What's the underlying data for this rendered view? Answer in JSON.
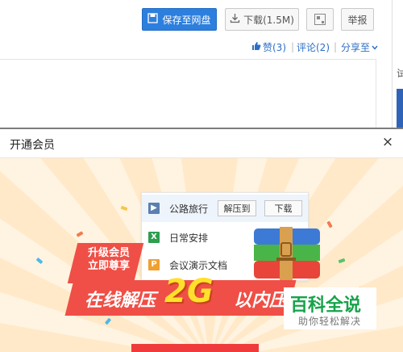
{
  "toolbar": {
    "save_label": "保存至网盘",
    "download_label": "下载(1.5M)",
    "report_label": "举报"
  },
  "social": {
    "like_label": "赞(3)",
    "comment_label": "评论(2)",
    "share_label": "分享至"
  },
  "sidebar": {
    "char": "试"
  },
  "modal": {
    "title": "开通会员",
    "close_glyph": "×"
  },
  "files": [
    {
      "name": "公路旅行",
      "icon": "video-file-icon",
      "color": "#5b7fb0",
      "glyph": "▶"
    },
    {
      "name": "日常安排",
      "icon": "excel-file-icon",
      "color": "#2e9e4f",
      "glyph": "X"
    },
    {
      "name": "会议演示文档",
      "icon": "ppt-file-icon",
      "color": "#f0a030",
      "glyph": "P"
    }
  ],
  "file_actions": {
    "extract_label": "解压到",
    "download_label": "下载"
  },
  "promo": {
    "upgrade_line1": "升级会员",
    "upgrade_line2": "立即尊享",
    "headline_left": "在线解压",
    "headline_big": "2G",
    "headline_right": "以内压缩"
  },
  "watermark": {
    "title": "百科全说",
    "subtitle": "助你轻松解决"
  },
  "colors": {
    "primary": "#2d7fde",
    "promo_red": "#ef4f46",
    "promo_yellow": "#ffe02b",
    "watermark_green": "#17a34a"
  }
}
